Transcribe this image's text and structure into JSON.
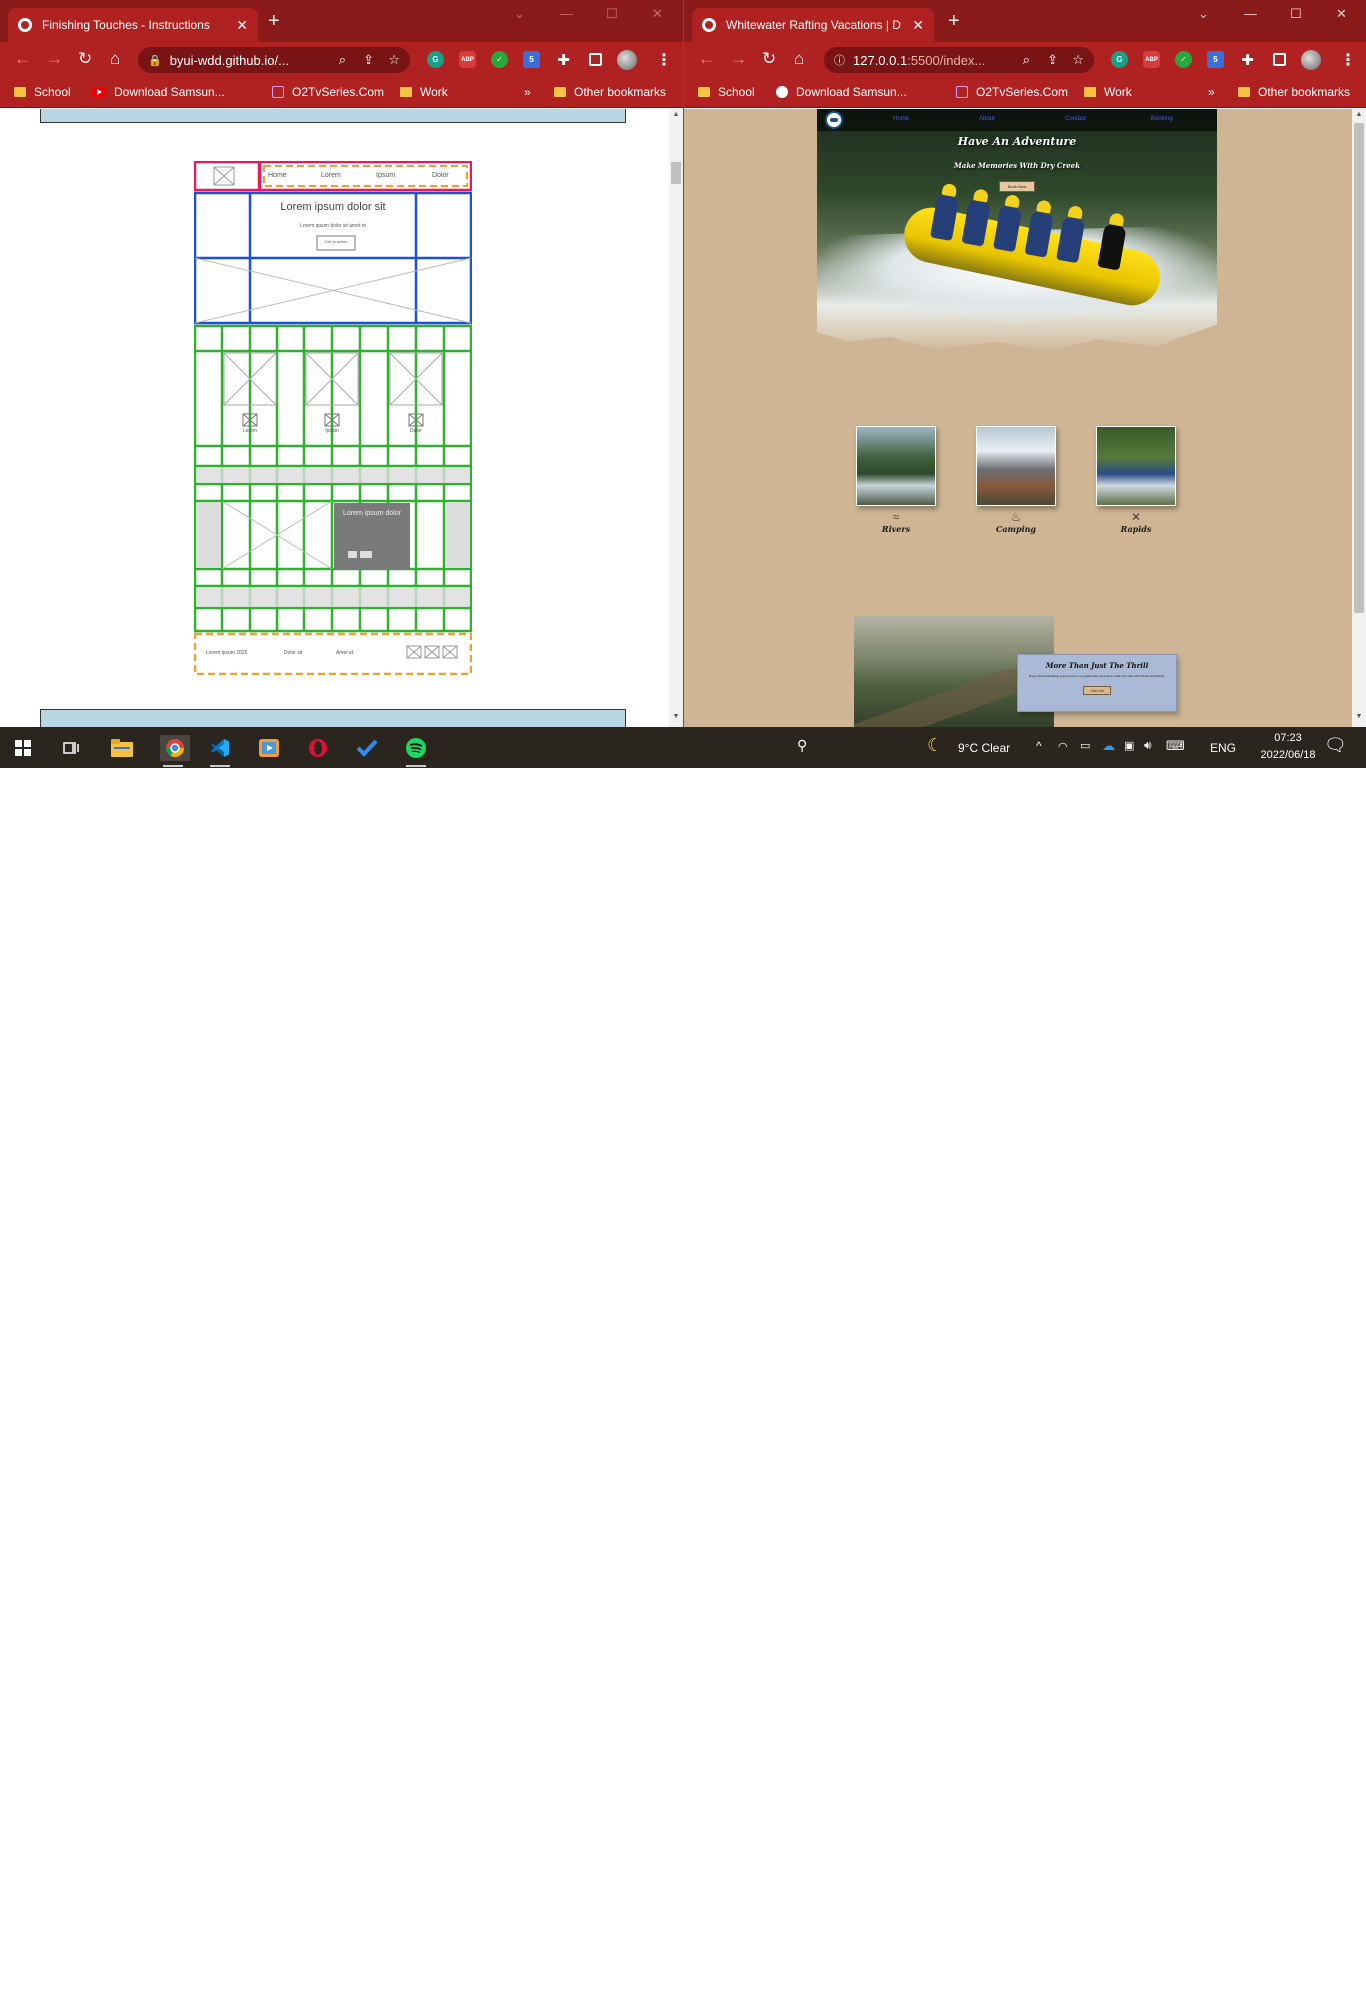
{
  "left_window": {
    "tab_title": "Finishing Touches - Instructions",
    "url": "byui-wdd.github.io/...",
    "bookmarks": [
      "School",
      "Download Samsun...",
      "O2TvSeries.Com",
      "Work"
    ],
    "other_bookmarks": "Other bookmarks",
    "wireframe": {
      "nav_items": [
        "Home",
        "Lorem",
        "Ipsum",
        "Dolor"
      ],
      "hero_heading": "Lorem ipsum dolor sit",
      "hero_sub": "Lorem ipsum dolor sit amet et",
      "hero_button": "Call to action",
      "card_labels": [
        "Lorem",
        "Ipsum",
        "Dolor"
      ],
      "promo_heading": "Lorem ipsum dolor",
      "footer_items": [
        "Lorem ipsum 2025",
        "Dolor sit",
        "Amet et"
      ]
    }
  },
  "right_window": {
    "tab_title": "Whitewater Rafting Vacations | D",
    "url": "127.0.0.1",
    "url_rest": ":5500/index...",
    "bookmarks": [
      "School",
      "Download Samsun...",
      "O2TvSeries.Com",
      "Work"
    ],
    "other_bookmarks": "Other bookmarks",
    "site": {
      "nav_links": [
        "Home",
        "About",
        "Contact",
        "Booking"
      ],
      "hero_title": "Have An Adventure",
      "hero_subtitle": "Make Memories With Dry Creek",
      "hero_button": "Book Now",
      "cards": [
        {
          "label": "Rivers",
          "icon": "river-icon"
        },
        {
          "label": "Camping",
          "icon": "campfire-icon"
        },
        {
          "label": "Rapids",
          "icon": "crossed-paddles-icon"
        }
      ],
      "promo_title": "More Than Just The Thrill",
      "promo_text": "Enjoy the breathtaking scenery from our guided trips and camp under the stars with friends and family.",
      "promo_button": "Join Us"
    }
  },
  "taskbar": {
    "weather": "9°C  Clear",
    "language": "ENG",
    "time": "07:23",
    "date": "2022/06/18",
    "apps": [
      "windows-start-icon",
      "task-view-icon",
      "file-explorer-icon",
      "chrome-icon",
      "vscode-icon",
      "media-player-icon",
      "opera-icon",
      "todo-icon",
      "spotify-icon"
    ]
  },
  "colors": {
    "chrome_frame": "#8b1a1a",
    "chrome_toolbar": "#b02222",
    "site_background": "#cfb593",
    "promo_box": "#a9b9d6",
    "wireframe_red": "#e8195a",
    "wireframe_blue": "#1e4fd8",
    "wireframe_green": "#2db22d",
    "wireframe_orange": "#f0a030"
  }
}
